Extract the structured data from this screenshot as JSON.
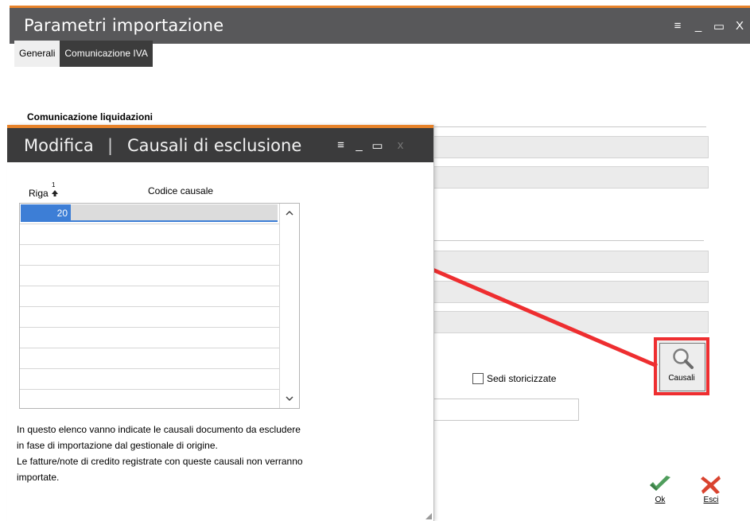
{
  "main_window": {
    "title": "Parametri importazione",
    "controls": [
      "≡",
      "_",
      "▭",
      "X"
    ],
    "tabs": [
      {
        "label": "Generali",
        "active": false
      },
      {
        "label": "Comunicazione IVA",
        "active": true
      }
    ],
    "section_title": "Comunicazione liquidazioni",
    "checkbox_label": "Sedi storicizzate",
    "causali_button_label": "Causali",
    "ok_label": "Ok",
    "esci_label": "Esci"
  },
  "dialog": {
    "title_left": "Modifica",
    "separator": "|",
    "title_right": "Causali di esclusione",
    "controls": [
      "≡",
      "_",
      "▭",
      "x"
    ],
    "columns": {
      "riga": "Riga",
      "sort_index": "1",
      "codice": "Codice causale"
    },
    "rows": [
      {
        "riga": "20",
        "codice": ""
      }
    ],
    "empty_rows": 9,
    "help_text": [
      "In questo elenco vanno indicate le causali documento da escludere",
      "in fase di importazione dal gestionale di origine.",
      "Le fatture/note di credito registrate con queste causali non verranno",
      "importate."
    ]
  },
  "colors": {
    "accent": "#e8832a",
    "highlight": "#ee2e30",
    "selection": "#3d7ed6",
    "ok_green": "#4f9d5c",
    "cancel_red": "#d9432f"
  }
}
